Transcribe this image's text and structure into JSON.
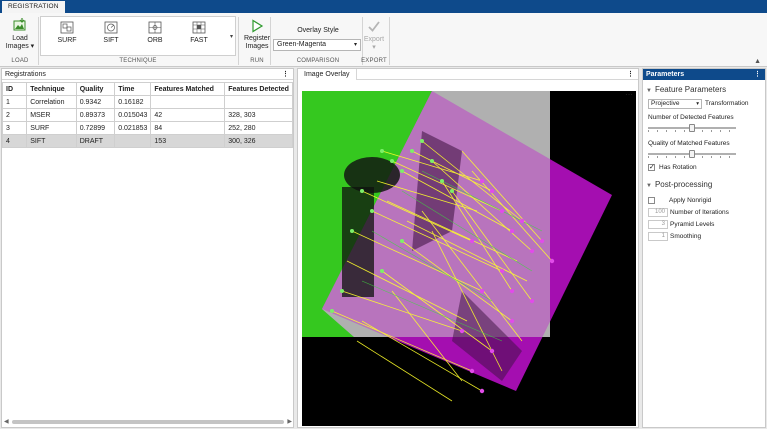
{
  "app": {
    "tab": "REGISTRATION"
  },
  "toolstrip": {
    "load": {
      "label_line1": "Load",
      "label_line2": "Images ▾",
      "group": "LOAD"
    },
    "technique": {
      "group": "TECHNIQUE",
      "items": [
        "SURF",
        "SIFT",
        "ORB",
        "FAST"
      ]
    },
    "run": {
      "label_line1": "Register",
      "label_line2": "Images",
      "group": "RUN"
    },
    "comparison": {
      "title": "Overlay Style",
      "selected": "Green-Magenta",
      "group": "COMPARISON"
    },
    "export": {
      "label": "Export",
      "caret": "▾",
      "group": "EXPORT"
    }
  },
  "registrations": {
    "title": "Registrations",
    "columns": [
      "ID",
      "Technique",
      "Quality",
      "Time",
      "Features Matched",
      "Features Detected"
    ],
    "rows": [
      [
        "1",
        "Correlation",
        "0.9342",
        "0.16182",
        "",
        ""
      ],
      [
        "2",
        "MSER",
        "0.89373",
        "0.015043",
        "42",
        "328, 303"
      ],
      [
        "3",
        "SURF",
        "0.72899",
        "0.021853",
        "84",
        "252, 280"
      ],
      [
        "4",
        "SIFT",
        "DRAFT",
        "",
        "153",
        "300, 326"
      ]
    ],
    "selected_row": 3
  },
  "image_overlay": {
    "tab": "Image Overlay"
  },
  "parameters": {
    "title": "Parameters",
    "feature": {
      "section": "Feature Parameters",
      "transformation_value": "Projective",
      "transformation_label": "Transformation",
      "detected_label": "Number of Detected Features",
      "detected_level": 0.5,
      "quality_label": "Quality of Matched Features",
      "quality_level": 0.5,
      "has_rotation_label": "Has Rotation",
      "has_rotation": true
    },
    "post": {
      "section": "Post-processing",
      "nonrigid_label": "Apply Nonrigid",
      "nonrigid": false,
      "iterations_value": "100",
      "iterations_label": "Number of Iterations",
      "pyramid_value": "3",
      "pyramid_label": "Pyramid Levels",
      "smoothing_value": "1",
      "smoothing_label": "Smoothing"
    }
  },
  "colors": {
    "accent": "#0e4a8b",
    "green": "#2fcd1e",
    "magenta": "#b000b8",
    "match_line": "#ffff00"
  }
}
